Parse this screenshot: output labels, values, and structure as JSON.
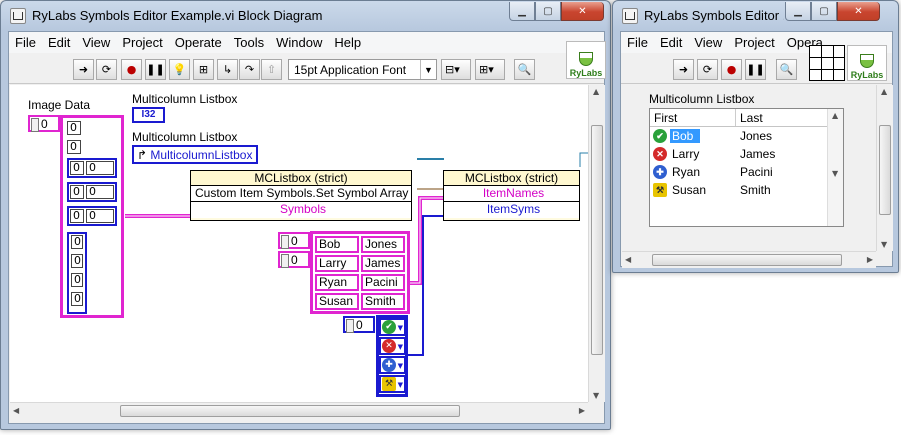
{
  "bd_window": {
    "title": "RyLabs Symbols Editor Example.vi Block Diagram",
    "menu": [
      "File",
      "Edit",
      "View",
      "Project",
      "Operate",
      "Tools",
      "Window",
      "Help"
    ],
    "font_select": "15pt Application Font",
    "logo_text": "RyLabs",
    "labels": {
      "image_data": "Image Data",
      "mclb_label_1": "Multicolumn Listbox",
      "mclb_label_2": "Multicolumn Listbox",
      "i32_tag": "I32",
      "mclb_ref": "MulticolumnListbox"
    },
    "node1": {
      "header": "MCListbox (strict)",
      "method": "Custom Item Symbols.Set Symbol Array",
      "param": "Symbols"
    },
    "node2": {
      "header": "MCListbox (strict)",
      "prop1": "ItemNames",
      "prop2": "ItemSyms"
    },
    "image_array": {
      "index": "0",
      "values": [
        "0",
        "0",
        "0",
        "0",
        "0",
        "0",
        "0",
        "0",
        "0",
        "0"
      ]
    },
    "names_array": {
      "index_row": "0",
      "index_col": "0",
      "rows": [
        [
          "Bob",
          "Jones"
        ],
        [
          "Larry",
          "James"
        ],
        [
          "Ryan",
          "Pacini"
        ],
        [
          "Susan",
          "Smith"
        ]
      ]
    },
    "symbols_array": {
      "index": "0",
      "items": [
        "check-icon",
        "x-icon",
        "plus-icon",
        "hammer-icon"
      ]
    }
  },
  "fp_window": {
    "title": "RyLabs Symbols Editor ...",
    "menu": [
      "File",
      "Edit",
      "View",
      "Project",
      "Opera"
    ],
    "logo_text": "RyLabs",
    "listbox_label": "Multicolumn Listbox",
    "columns": [
      "First",
      "Last"
    ],
    "rows": [
      {
        "icon": "check-icon",
        "first": "Bob",
        "last": "Jones",
        "selected": true
      },
      {
        "icon": "x-icon",
        "first": "Larry",
        "last": "James",
        "selected": false
      },
      {
        "icon": "plus-icon",
        "first": "Ryan",
        "last": "Pacini",
        "selected": false
      },
      {
        "icon": "hammer-icon",
        "first": "Susan",
        "last": "Smith",
        "selected": false
      }
    ]
  },
  "colors": {
    "string_wire": "#e025d0",
    "numeric_wire": "#1a1ad0",
    "ref_wire": "#2a7fa8",
    "check": "#2aa13a",
    "x": "#d42a2a",
    "plus": "#2f5fd0",
    "hammer": "#e8c400"
  }
}
